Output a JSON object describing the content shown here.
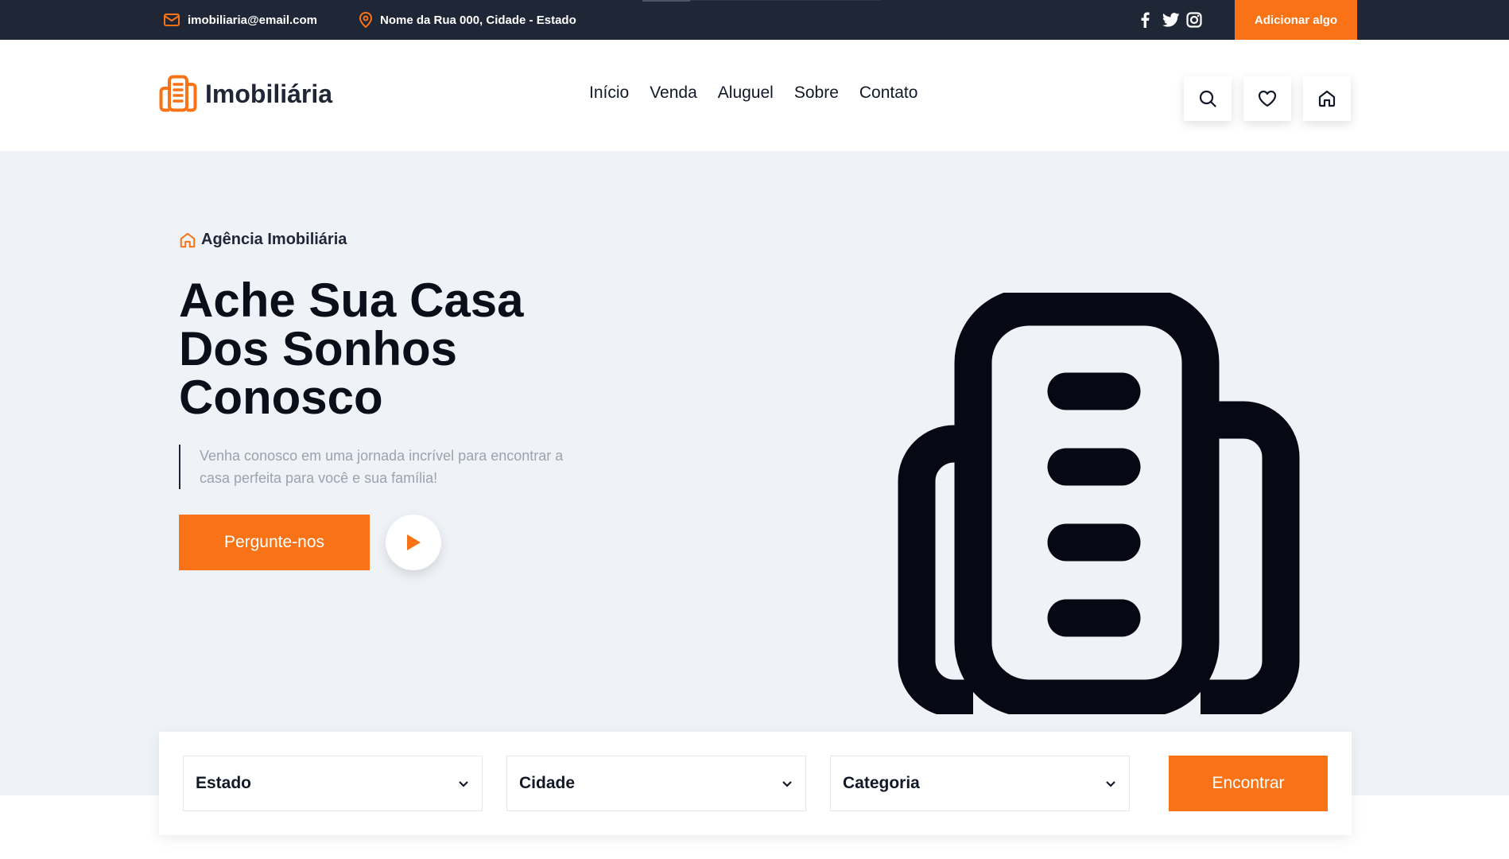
{
  "topbar": {
    "email": "imobiliaria@email.com",
    "address": "Nome da Rua 000, Cidade - Estado",
    "cta_label": "Adicionar algo"
  },
  "header": {
    "logo_text": "Imobiliária",
    "nav": [
      "Início",
      "Venda",
      "Aluguel",
      "Sobre",
      "Contato"
    ]
  },
  "hero": {
    "tagline": "Agência Imobiliária",
    "title_lines": [
      "Ache Sua Casa",
      "Dos Sonhos",
      "Conosco"
    ],
    "description_lines": [
      "Venha conosco em uma jornada incrível para encontrar a",
      "casa perfeita para você e sua família!"
    ],
    "ask_button": "Pergunte-nos"
  },
  "search": {
    "estado": "Estado",
    "cidade": "Cidade",
    "categoria": "Categoria",
    "find_button": "Encontrar"
  },
  "colors": {
    "accent": "#f97316",
    "dark": "#1f2636",
    "hero_bg": "#eff2f7"
  }
}
